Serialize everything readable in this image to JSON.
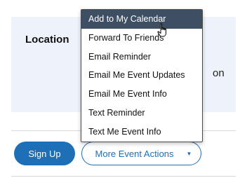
{
  "location": {
    "label": "Location",
    "value_fragment": "on"
  },
  "buttons": {
    "signup_label": "Sign Up",
    "more_actions_label": "More Event Actions",
    "more_actions_caret": "▼"
  },
  "menu": {
    "items": [
      {
        "label": "Add to My Calendar",
        "state": "hover"
      },
      {
        "label": "Forward To Friends"
      },
      {
        "label": "Email Reminder"
      },
      {
        "label": "Email Me Event Updates"
      },
      {
        "label": "Email Me Event Info"
      },
      {
        "label": "Text Reminder"
      },
      {
        "label": "Text Me Event Info"
      }
    ]
  },
  "colors": {
    "accent": "#1f6fb6",
    "panel_bg": "#eef3fb",
    "menu_hover_bg": "#3f4f63"
  },
  "icons": {
    "cursor": "hand-pointer-icon",
    "dropdown_caret": "caret-down-icon"
  }
}
